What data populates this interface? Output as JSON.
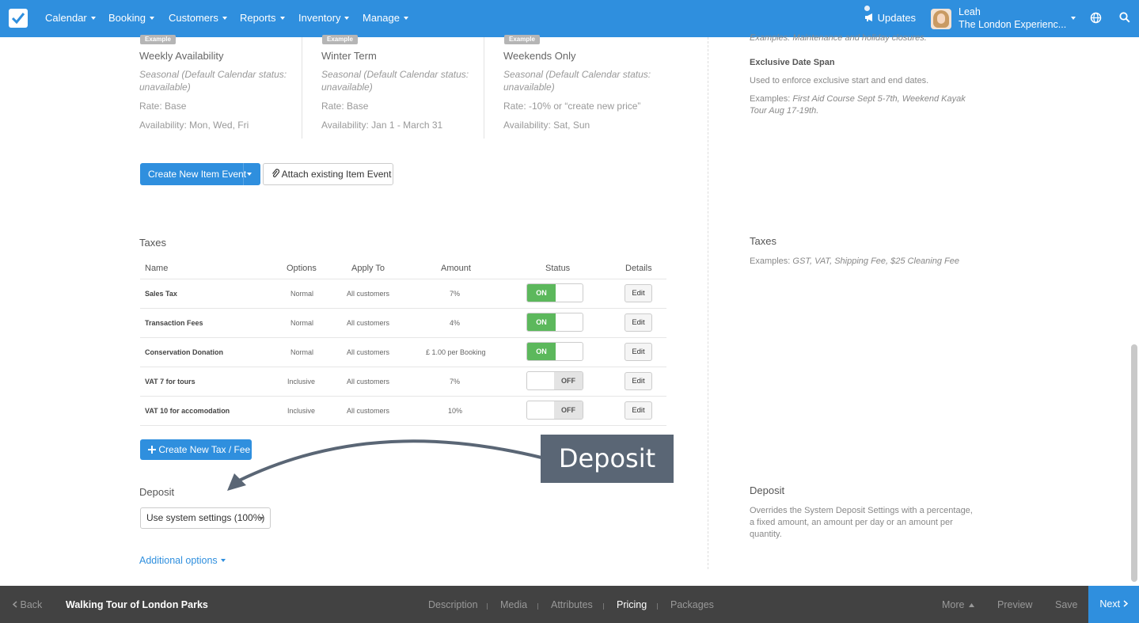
{
  "nav": {
    "items": [
      {
        "label": "Calendar",
        "icon": "chevron-down-icon"
      },
      {
        "label": "Booking",
        "icon": "chevron-down-icon"
      },
      {
        "label": "Customers",
        "icon": "chevron-down-icon"
      },
      {
        "label": "Reports",
        "icon": "chevron-down-icon"
      },
      {
        "label": "Inventory",
        "icon": "chevron-down-icon"
      },
      {
        "label": "Manage",
        "icon": "chevron-down-icon"
      }
    ],
    "updates": "Updates",
    "user_name": "Leah",
    "user_org": "The London Experienc...",
    "accent": "#2f8fde"
  },
  "examples": [
    {
      "badge": "Example",
      "title": "Weekly Availability",
      "seasonal": "Seasonal (Default Calendar status: unavailable)",
      "rate": "Rate: Base",
      "availability": "Availability: Mon, Wed, Fri"
    },
    {
      "badge": "Example",
      "title": "Winter Term",
      "seasonal": "Seasonal (Default Calendar status: unavailable)",
      "rate": "Rate: Base",
      "availability": "Availability: Jan 1 - March 31"
    },
    {
      "badge": "Example",
      "title": "Weekends Only",
      "seasonal": "Seasonal (Default Calendar status: unavailable)",
      "rate": "Rate: -10% or “create new price”",
      "availability": "Availability: Sat, Sun"
    }
  ],
  "buttons": {
    "create_item_event": "Create New Item Event",
    "attach_item_event": "Attach existing Item Event",
    "create_tax": "Create New Tax / Fee"
  },
  "taxes": {
    "title": "Taxes",
    "columns": [
      "Name",
      "Options",
      "Apply To",
      "Amount",
      "Status",
      "Details"
    ],
    "rows": [
      {
        "name": "Sales Tax",
        "options": "Normal",
        "apply_to": "All customers",
        "amount": "7%",
        "status": "ON",
        "details": "Edit"
      },
      {
        "name": "Transaction Fees",
        "options": "Normal",
        "apply_to": "All customers",
        "amount": "4%",
        "status": "ON",
        "details": "Edit"
      },
      {
        "name": "Conservation Donation",
        "options": "Normal",
        "apply_to": "All customers",
        "amount": "£ 1.00 per Booking",
        "status": "ON",
        "details": "Edit"
      },
      {
        "name": "VAT 7 for tours",
        "options": "Inclusive",
        "apply_to": "All customers",
        "amount": "7%",
        "status": "OFF",
        "details": "Edit"
      },
      {
        "name": "VAT 10 for accomodation",
        "options": "Inclusive",
        "apply_to": "All customers",
        "amount": "10%",
        "status": "OFF",
        "details": "Edit"
      }
    ]
  },
  "deposit": {
    "title": "Deposit",
    "selected": "Use system settings (100%)",
    "callout": "Deposit"
  },
  "additional_options": "Additional options",
  "right": {
    "top_example": "Examples: Maintenance and holiday closures.",
    "exclusive_title": "Exclusive Date Span",
    "exclusive_desc": "Used to enforce exclusive start and end dates.",
    "exclusive_examples_prefix": "Examples: ",
    "exclusive_examples": "First Aid Course Sept 5-7th, Weekend Kayak Tour Aug 17-19th.",
    "taxes_title": "Taxes",
    "taxes_examples_prefix": "Examples: ",
    "taxes_examples": "GST, VAT, Shipping Fee, $25 Cleaning Fee",
    "deposit_title": "Deposit",
    "deposit_desc": "Overrides the System Deposit Settings with a percentage, a fixed amount, an amount per day or an amount per quantity."
  },
  "bottom": {
    "back": "Back",
    "title": "Walking Tour of London Parks",
    "tabs": [
      "Description",
      "Media",
      "Attributes",
      "Pricing",
      "Packages"
    ],
    "active_tab": "Pricing",
    "more": "More",
    "preview": "Preview",
    "save": "Save",
    "next": "Next"
  }
}
